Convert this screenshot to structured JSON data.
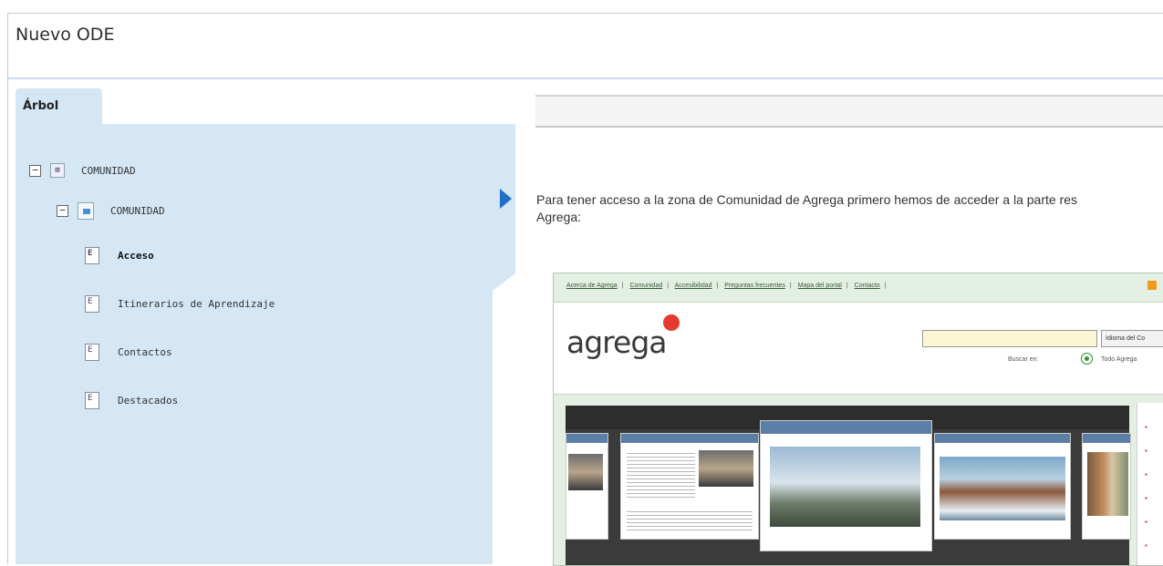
{
  "window": {
    "title": "Nuevo ODE"
  },
  "tree_panel": {
    "tab_label": "Árbol",
    "nodes": [
      {
        "label": "COMUNIDAD"
      },
      {
        "label": "COMUNIDAD"
      },
      {
        "label": "Acceso"
      },
      {
        "label": "Itinerarios de Aprendizaje"
      },
      {
        "label": "Contactos"
      },
      {
        "label": "Destacados"
      }
    ]
  },
  "content": {
    "paragraph_line1": "Para tener acceso a la zona de Comunidad de Agrega primero hemos de acceder a la parte res",
    "paragraph_line2": "Agrega:",
    "screenshot": {
      "nav_links": [
        "Acerca de Agrega",
        "Comunidad",
        "Accesibilidad",
        "Preguntas frecuentes",
        "Mapa del portal",
        "Contacto"
      ],
      "logo_text": "agrega",
      "language_button": "Idioma del Co",
      "search_in_label": "Buscar en:",
      "search_scope": "Todo Agrega",
      "colors": {
        "logo_dot": "#e53b2f",
        "accent": "#f39a1c"
      }
    }
  }
}
